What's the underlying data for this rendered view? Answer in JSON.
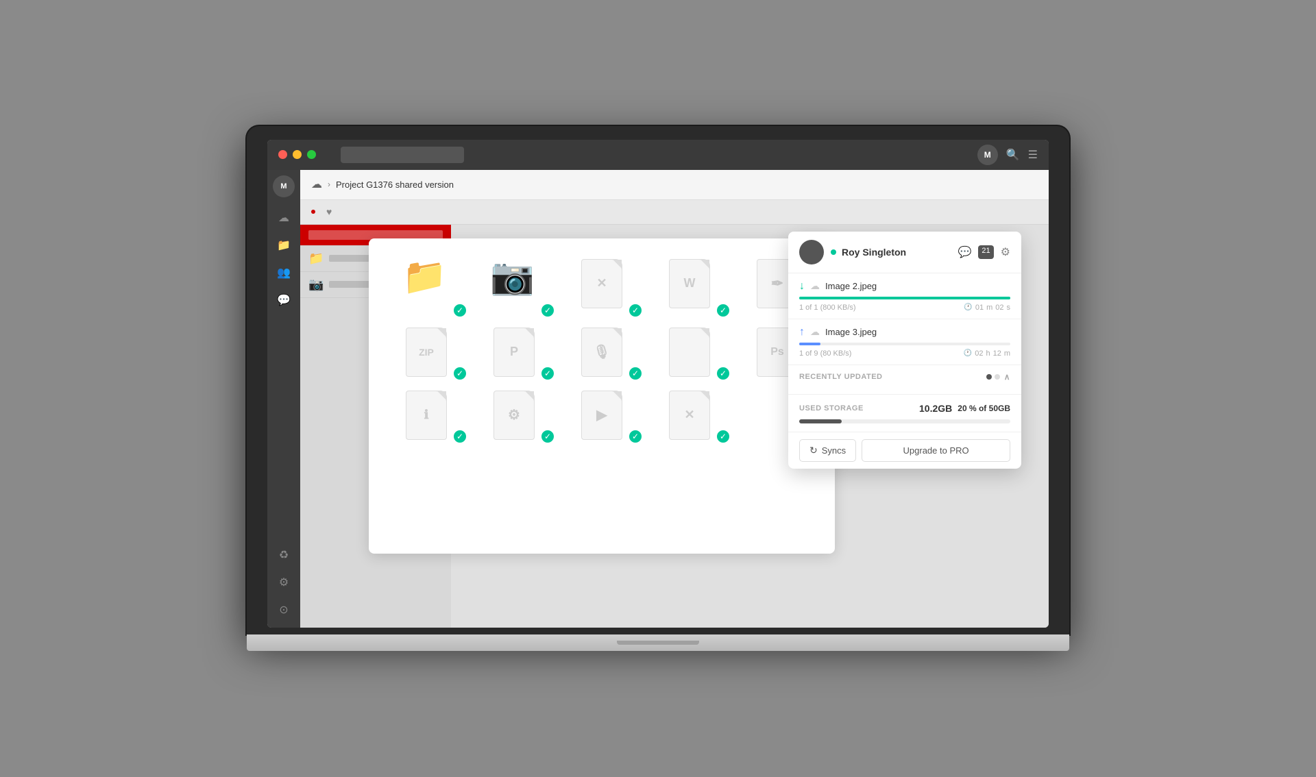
{
  "topBar": {
    "trafficLights": [
      "red",
      "yellow",
      "green"
    ],
    "avatarLabel": "M",
    "searchPlaceholder": "",
    "icons": [
      "search",
      "menu"
    ]
  },
  "sidebar": {
    "avatarLabel": "M",
    "items": [
      {
        "name": "cloud",
        "icon": "☁"
      },
      {
        "name": "folder",
        "icon": "📁"
      },
      {
        "name": "users",
        "icon": "👥"
      },
      {
        "name": "chat",
        "icon": "💬"
      }
    ],
    "bottomItems": [
      {
        "name": "recycle",
        "icon": "♻"
      },
      {
        "name": "settings",
        "icon": "⚙"
      },
      {
        "name": "info",
        "icon": "ℹ"
      }
    ]
  },
  "navBar": {
    "cloudIcon": "☁",
    "breadcrumb": "Project G1376 shared version"
  },
  "fileGrid": {
    "files": [
      {
        "type": "folder",
        "label": "",
        "hasCamera": false
      },
      {
        "type": "folder",
        "label": "",
        "hasCamera": true
      },
      {
        "type": "file",
        "label": "X"
      },
      {
        "type": "file",
        "label": "W"
      },
      {
        "type": "file",
        "label": ""
      },
      {
        "type": "file",
        "label": ""
      },
      {
        "type": "file",
        "label": "P"
      },
      {
        "type": "file",
        "label": ""
      },
      {
        "type": "file",
        "label": ""
      },
      {
        "type": "file",
        "label": "Ps"
      },
      {
        "type": "file",
        "label": ""
      },
      {
        "type": "file",
        "label": "⚙"
      },
      {
        "type": "file",
        "label": "▶"
      },
      {
        "type": "file",
        "label": "X"
      }
    ]
  },
  "popup": {
    "userName": "Roy Singleton",
    "onlineStatus": "online",
    "notificationCount": "21",
    "download": {
      "direction": "down",
      "filename": "Image 2.jpeg",
      "progress": 100,
      "count": "1 of 1",
      "speed": "(800 KB/s)",
      "time": {
        "hours": "01",
        "minutesLabel": "m",
        "seconds": "02",
        "secondsLabel": "s"
      }
    },
    "upload": {
      "direction": "up",
      "filename": "Image 3.jpeg",
      "progress": 10,
      "count": "1 of 9",
      "speed": "(80 KB/s)",
      "time": {
        "hours": "02",
        "hoursLabel": "h",
        "minutes": "12",
        "minutesLabel": "m"
      }
    },
    "recentlyUpdated": {
      "label": "RECENTLY UPDATED",
      "dots": [
        true,
        false
      ]
    },
    "storage": {
      "label": "USED STORAGE",
      "used": "10.2GB",
      "percentage": "20",
      "total": "50GB",
      "fillWidth": "20"
    },
    "footer": {
      "syncsLabel": "Syncs",
      "upgradeLabel": "Upgrade to PRO"
    }
  }
}
